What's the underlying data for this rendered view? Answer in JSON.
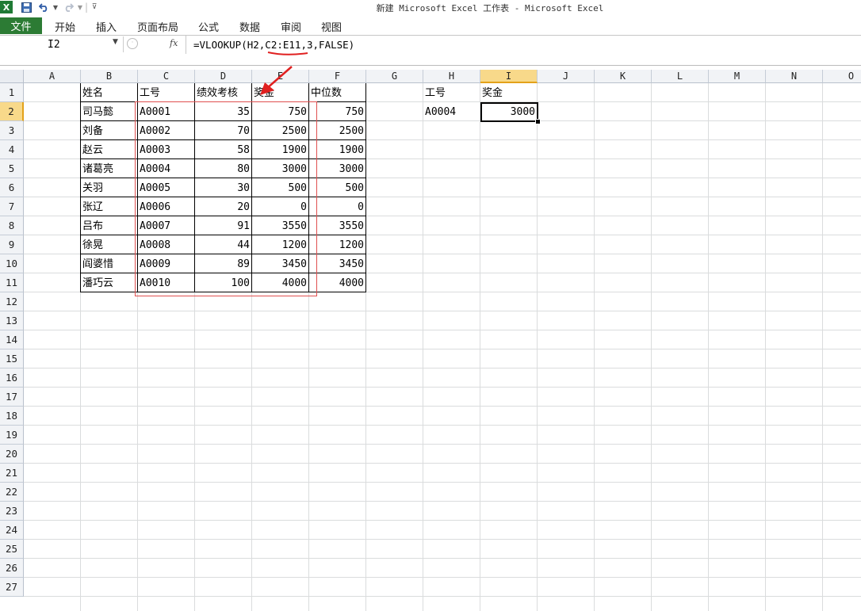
{
  "window": {
    "title": "新建 Microsoft Excel 工作表 - Microsoft Excel",
    "app_icon": "X"
  },
  "quick_access": {
    "save_icon": "save-icon",
    "undo_icon": "undo-icon",
    "redo_icon": "redo-icon"
  },
  "ribbon": {
    "file_tab": "文件",
    "tabs": [
      "开始",
      "插入",
      "页面布局",
      "公式",
      "数据",
      "审阅",
      "视图"
    ]
  },
  "formula_bar": {
    "name_box": "I2",
    "fx_label": "fx",
    "formula": "=VLOOKUP(H2,C2:E11,3,FALSE)"
  },
  "grid": {
    "columns": [
      "A",
      "B",
      "C",
      "D",
      "E",
      "F",
      "G",
      "H",
      "I",
      "J",
      "K",
      "L",
      "M",
      "N",
      "O"
    ],
    "rows": [
      "1",
      "2",
      "3",
      "4",
      "5",
      "6",
      "7",
      "8",
      "9",
      "10",
      "11",
      "12",
      "13",
      "14",
      "15",
      "16",
      "17",
      "18",
      "19",
      "20",
      "21",
      "22",
      "23",
      "24",
      "25",
      "26",
      "27"
    ],
    "active_column": "I",
    "active_row": "2"
  },
  "table": {
    "headers": [
      "姓名",
      "工号",
      "绩效考核",
      "奖金",
      "中位数"
    ],
    "rows": [
      [
        "司马懿",
        "A0001",
        "35",
        "750",
        "750"
      ],
      [
        "刘备",
        "A0002",
        "70",
        "2500",
        "2500"
      ],
      [
        "赵云",
        "A0003",
        "58",
        "1900",
        "1900"
      ],
      [
        "诸葛亮",
        "A0004",
        "80",
        "3000",
        "3000"
      ],
      [
        "关羽",
        "A0005",
        "30",
        "500",
        "500"
      ],
      [
        "张辽",
        "A0006",
        "20",
        "0",
        "0"
      ],
      [
        "吕布",
        "A0007",
        "91",
        "3550",
        "3550"
      ],
      [
        "徐晃",
        "A0008",
        "44",
        "1200",
        "1200"
      ],
      [
        "阎婆惜",
        "A0009",
        "89",
        "3450",
        "3450"
      ],
      [
        "潘巧云",
        "A0010",
        "100",
        "4000",
        "4000"
      ]
    ]
  },
  "lookup": {
    "h1": "工号",
    "i1": "奖金",
    "h2": "A0004",
    "i2": "3000"
  },
  "colors": {
    "file_tab": "#2c7b34",
    "annotation_red": "#e02020",
    "active_header": "#f8d98a"
  }
}
